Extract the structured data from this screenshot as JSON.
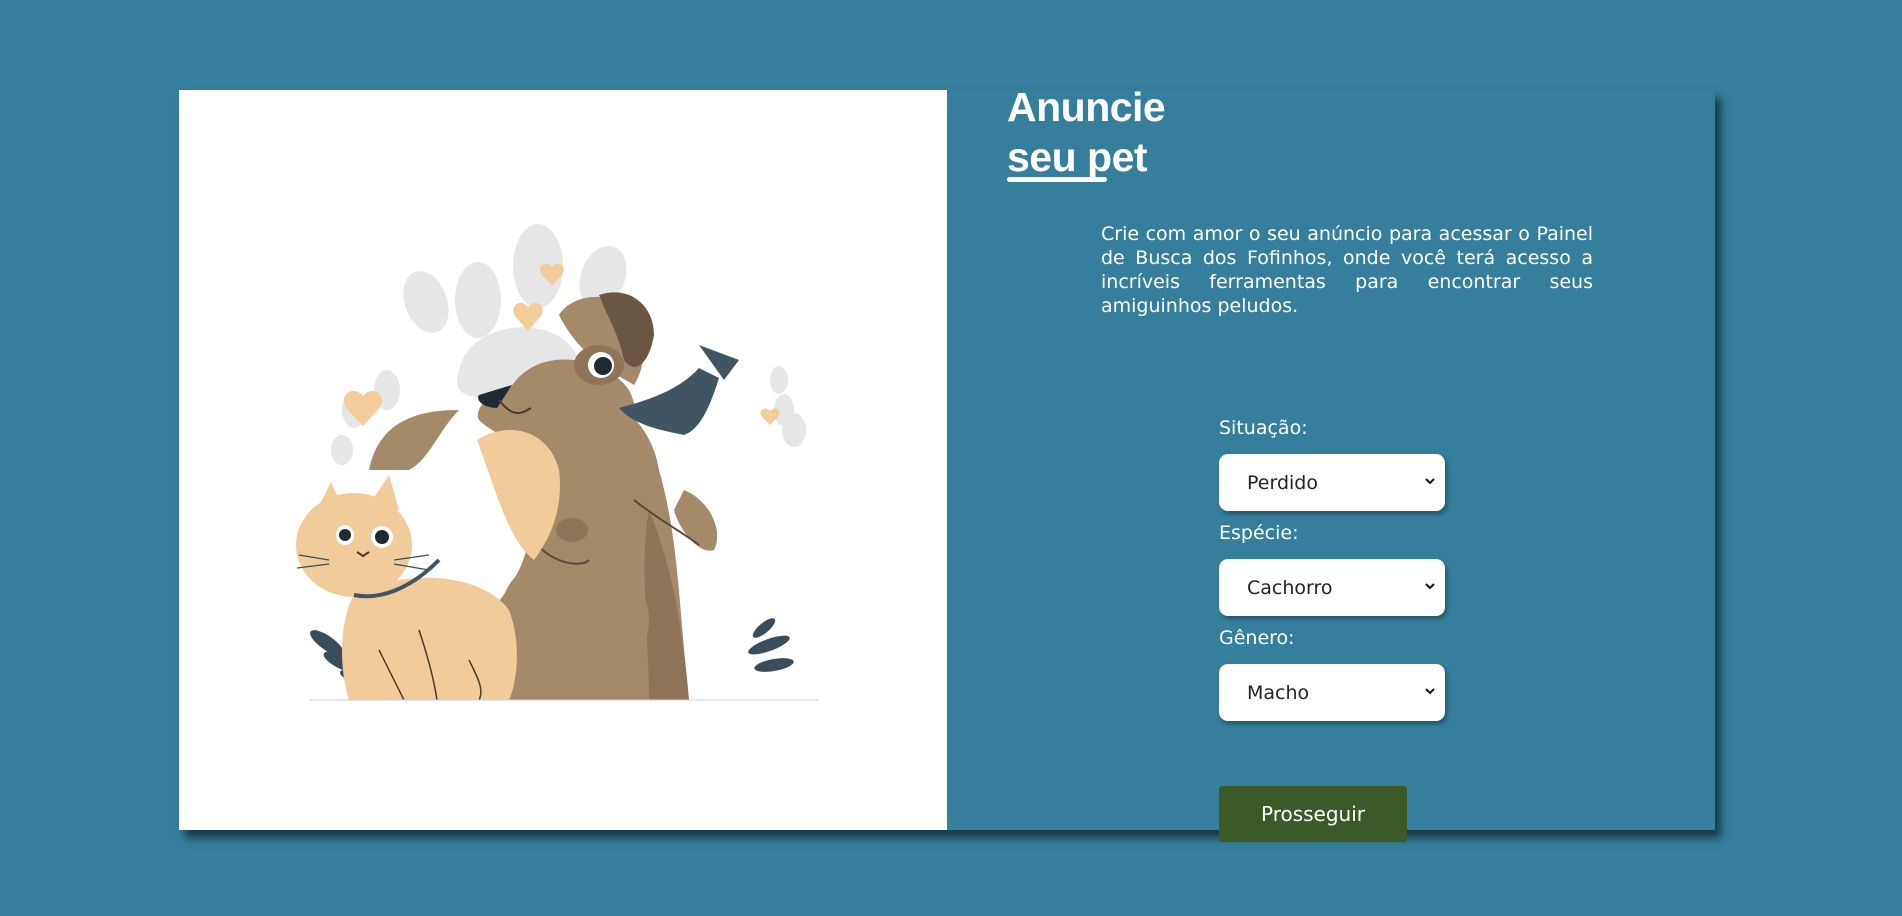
{
  "heading": {
    "line1": "Anuncie",
    "line2": "seu pet"
  },
  "description": "Crie com amor o seu anúncio para acessar o Painel de Busca dos Fofinhos, onde você terá acesso a incríveis ferramentas para encontrar seus amiguinhos peludos.",
  "form": {
    "situacao": {
      "label": "Situação:",
      "value": "Perdido"
    },
    "especie": {
      "label": "Espécie:",
      "value": "Cachorro"
    },
    "genero": {
      "label": "Gênero:",
      "value": "Macho"
    },
    "submit_label": "Prosseguir"
  },
  "colors": {
    "background": "#357f9c",
    "button": "#3a5a28",
    "panel": "#ffffff"
  },
  "illustration": "cat-and-dog-icon"
}
